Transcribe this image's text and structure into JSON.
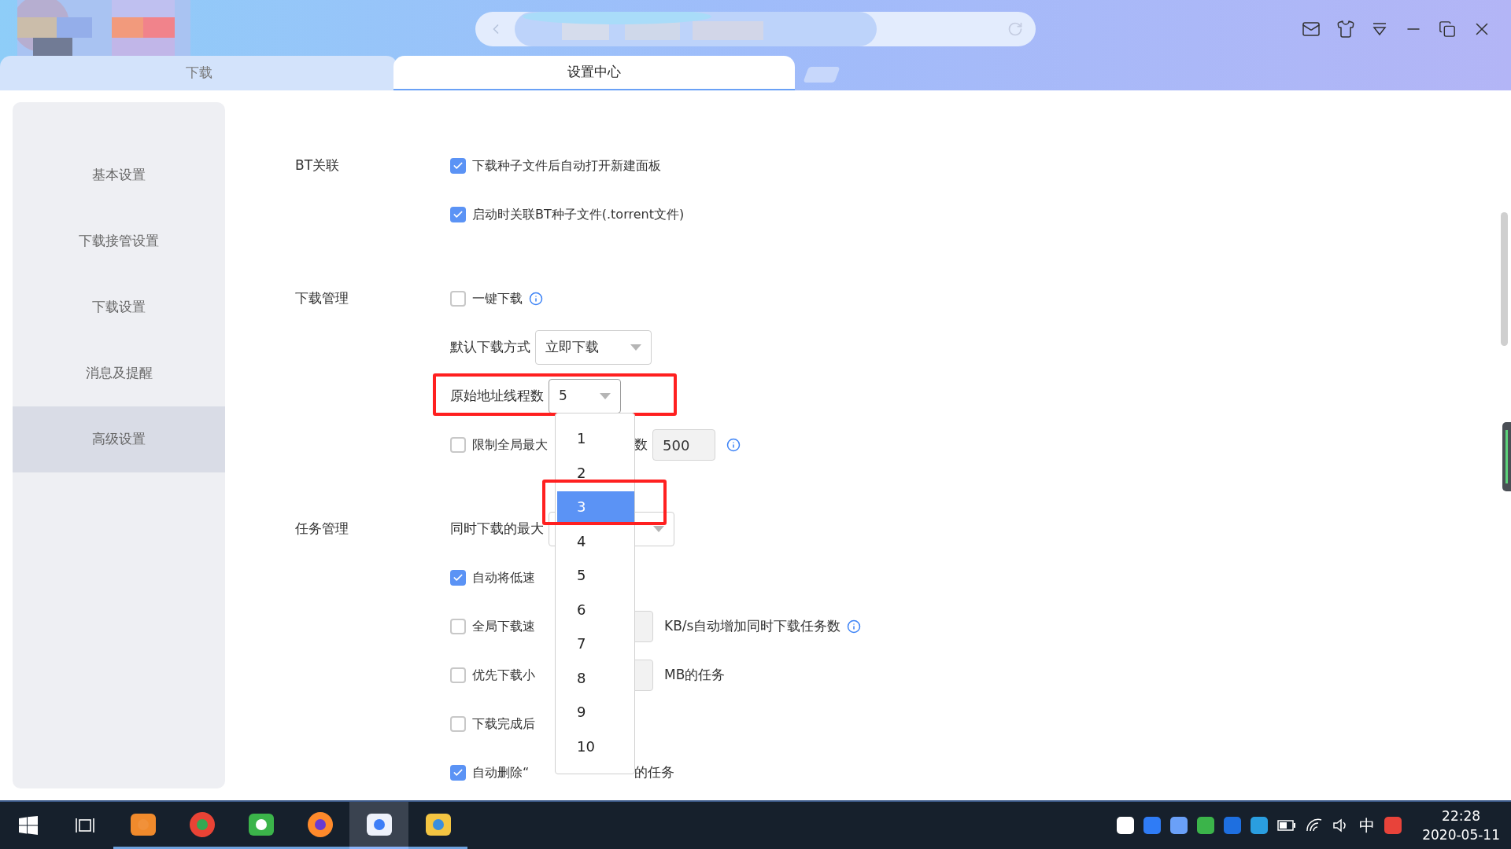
{
  "window": {
    "tabs": [
      {
        "label": "下载",
        "selected": false
      },
      {
        "label": "设置中心",
        "selected": true
      }
    ]
  },
  "sidebar": {
    "items": [
      {
        "label": "基本设置",
        "selected": false
      },
      {
        "label": "下载接管设置",
        "selected": false
      },
      {
        "label": "下载设置",
        "selected": false
      },
      {
        "label": "消息及提醒",
        "selected": false
      },
      {
        "label": "高级设置",
        "selected": true
      }
    ]
  },
  "sections": [
    {
      "title": "BT关联",
      "rows": [
        {
          "kind": "checkbox",
          "checked": true,
          "text": "下载种子文件后自动打开新建面板"
        },
        {
          "kind": "checkbox",
          "checked": true,
          "text": "启动时关联BT种子文件(.torrent文件)"
        }
      ]
    },
    {
      "title": "下载管理",
      "rows": [
        {
          "kind": "checkbox",
          "checked": false,
          "text": "一键下载",
          "info": true
        },
        {
          "kind": "select",
          "label": "默认下载方式",
          "value": "立即下载"
        },
        {
          "kind": "select",
          "label": "原始地址线程数",
          "value": "5",
          "annotated": true,
          "open": true
        },
        {
          "kind": "checkbox",
          "checked": false,
          "text": "限制全局最大",
          "text_after": "数",
          "field": "500",
          "info": true
        }
      ]
    },
    {
      "title": "任务管理",
      "rows": [
        {
          "kind": "select",
          "label": "同时下载的最大"
        },
        {
          "kind": "checkbox",
          "checked": true,
          "text": "自动将低速"
        },
        {
          "kind": "checkbox",
          "checked": false,
          "text": "全局下载速",
          "field": "",
          "text_after": "KB/s自动增加同时下载任务数",
          "info": true
        },
        {
          "kind": "checkbox",
          "checked": false,
          "text": "优先下载小",
          "field": "",
          "text_after": "MB的任务"
        },
        {
          "kind": "checkbox",
          "checked": false,
          "text": "下载完成后"
        },
        {
          "kind": "checkbox",
          "checked": true,
          "text": "自动删除“",
          "text_after": "的任务"
        }
      ]
    }
  ],
  "dropdown": {
    "options": [
      {
        "label": "1",
        "selected": false
      },
      {
        "label": "2",
        "selected": false
      },
      {
        "label": "3",
        "selected": true,
        "annotated": true
      },
      {
        "label": "4",
        "selected": false
      },
      {
        "label": "5",
        "selected": false
      },
      {
        "label": "6",
        "selected": false
      },
      {
        "label": "7",
        "selected": false
      },
      {
        "label": "8",
        "selected": false
      },
      {
        "label": "9",
        "selected": false
      },
      {
        "label": "10",
        "selected": false
      }
    ]
  },
  "taskbar": {
    "ime": "中",
    "time": "22:28",
    "date": "2020-05-11"
  }
}
